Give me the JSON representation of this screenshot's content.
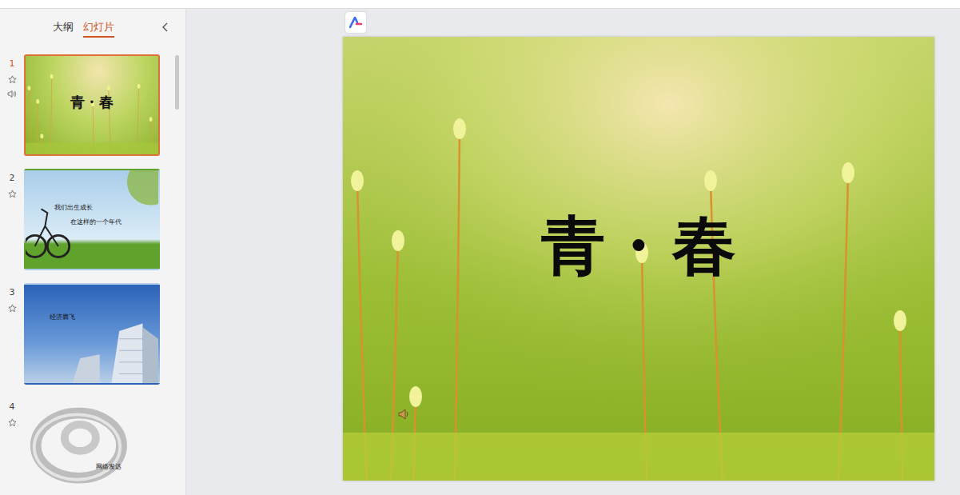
{
  "app": {
    "name": "WPS 演示"
  },
  "panel_tabs": [
    {
      "label": "大纲",
      "selected": false
    },
    {
      "label": "幻灯片",
      "selected": true
    }
  ],
  "slides": [
    {
      "number": "1",
      "selected": true,
      "has_audio": true,
      "kind": "moss",
      "texts": [
        "青 · 春"
      ]
    },
    {
      "number": "2",
      "selected": false,
      "has_audio": false,
      "kind": "bicycle",
      "texts": [
        "我们出生成长",
        "在这样的一个年代"
      ]
    },
    {
      "number": "3",
      "selected": false,
      "has_audio": false,
      "kind": "city",
      "texts": [
        "经济腾飞"
      ]
    },
    {
      "number": "4",
      "selected": false,
      "has_audio": false,
      "kind": "network",
      "texts": [
        "网络发达"
      ]
    }
  ],
  "current_slide": {
    "title": "青 · 春",
    "has_audio": true
  }
}
